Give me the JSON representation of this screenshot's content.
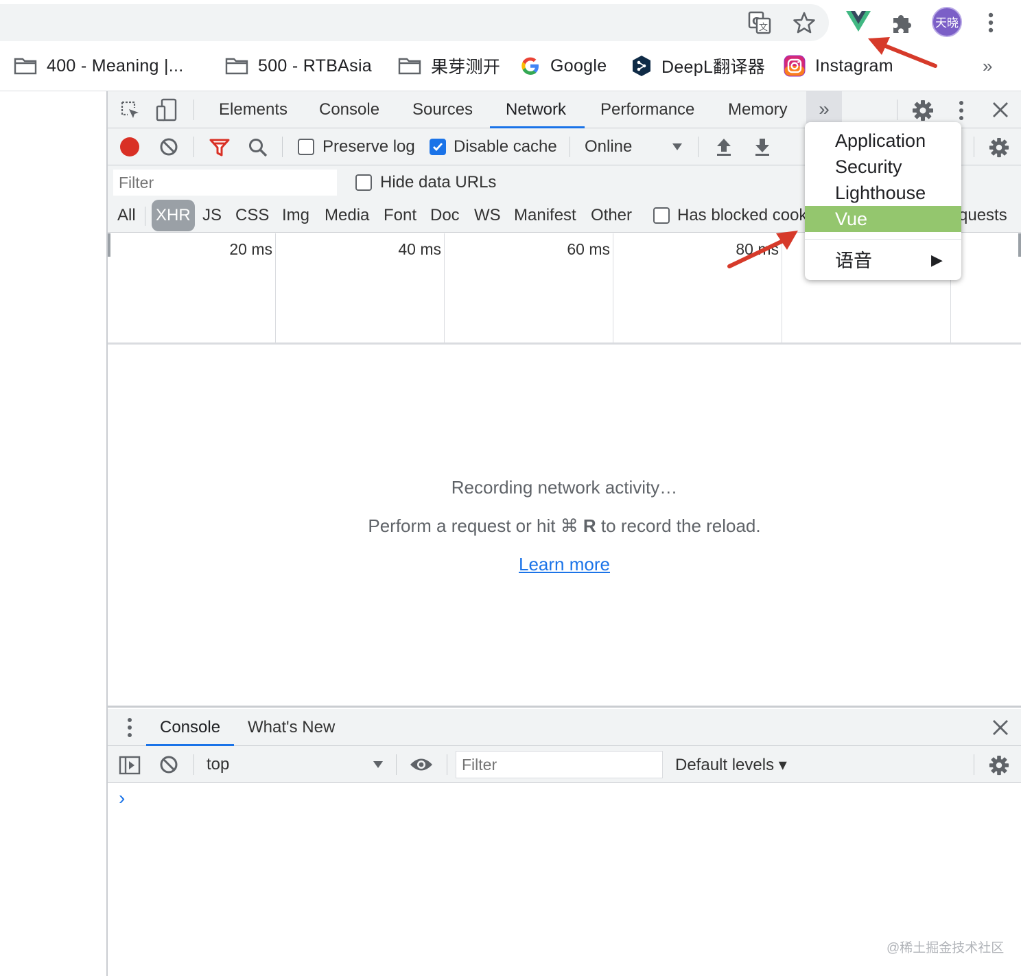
{
  "browser": {
    "toolbar_icons": [
      "translate-icon",
      "star-icon",
      "vue-devtools-icon",
      "puzzle-icon",
      "avatar",
      "more-vert-icon"
    ],
    "avatar_text": "天晓",
    "avatar_color": "#7b5fc7",
    "bookmarks": [
      {
        "label": "400 - Meaning |...",
        "icon": "folder-icon"
      },
      {
        "label": "500 - RTBAsia",
        "icon": "folder-icon"
      },
      {
        "label": "果芽测开",
        "icon": "folder-icon"
      },
      {
        "label": "Google",
        "icon": "google-icon"
      },
      {
        "label": "DeepL翻译器",
        "icon": "deepl-icon"
      },
      {
        "label": "Instagram",
        "icon": "instagram-icon"
      }
    ],
    "bookmarks_overflow": "»"
  },
  "devtools": {
    "tabs": [
      "Elements",
      "Console",
      "Sources",
      "Network",
      "Performance",
      "Memory"
    ],
    "active_tab": "Network",
    "overflow_label": "»",
    "toolbar": {
      "preserve_log": "Preserve log",
      "disable_cache": "Disable cache",
      "throttle": "Online"
    },
    "filter": {
      "placeholder": "Filter",
      "hide_data_urls": "Hide data URLs"
    },
    "types": [
      "All",
      "XHR",
      "JS",
      "CSS",
      "Img",
      "Media",
      "Font",
      "Doc",
      "WS",
      "Manifest",
      "Other"
    ],
    "selected_type": "XHR",
    "blocked_cookies": "Has blocked cook",
    "blocked_requests_tail": "quests",
    "timeline_ticks": [
      "20 ms",
      "40 ms",
      "60 ms",
      "80 ms"
    ],
    "empty": {
      "line1": "Recording network activity…",
      "line2_pre": "Perform a request or hit ⌘ ",
      "line2_key": "R",
      "line2_post": " to record the reload.",
      "link": "Learn more"
    },
    "overflow_menu": {
      "items": [
        "Application",
        "Security",
        "Lighthouse",
        "Vue"
      ],
      "highlighted": "Vue",
      "highlight_color": "#94c66e",
      "submenu": "语音",
      "submenu_arrow": "▶"
    },
    "drawer": {
      "tabs": [
        "Console",
        "What's New"
      ],
      "active_tab": "Console",
      "context": "top",
      "filter_placeholder": "Filter",
      "levels": "Default levels ▾",
      "prompt": "›"
    }
  },
  "watermark": "@稀土掘金技术社区",
  "colors": {
    "accent": "#1a73e8",
    "record": "#d93025",
    "annotation_arrow": "#d63a2a",
    "vue_green": "#41b883"
  }
}
